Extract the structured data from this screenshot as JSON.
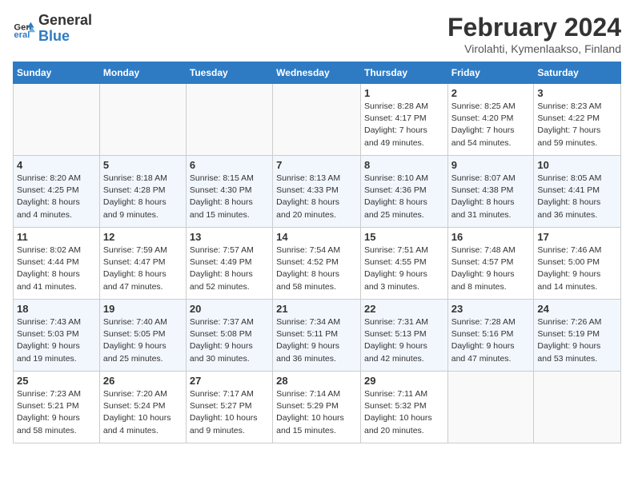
{
  "logo": {
    "line1": "General",
    "line2": "Blue"
  },
  "title": "February 2024",
  "location": "Virolahti, Kymenlaakso, Finland",
  "weekdays": [
    "Sunday",
    "Monday",
    "Tuesday",
    "Wednesday",
    "Thursday",
    "Friday",
    "Saturday"
  ],
  "weeks": [
    [
      {
        "day": "",
        "info": ""
      },
      {
        "day": "",
        "info": ""
      },
      {
        "day": "",
        "info": ""
      },
      {
        "day": "",
        "info": ""
      },
      {
        "day": "1",
        "info": "Sunrise: 8:28 AM\nSunset: 4:17 PM\nDaylight: 7 hours\nand 49 minutes."
      },
      {
        "day": "2",
        "info": "Sunrise: 8:25 AM\nSunset: 4:20 PM\nDaylight: 7 hours\nand 54 minutes."
      },
      {
        "day": "3",
        "info": "Sunrise: 8:23 AM\nSunset: 4:22 PM\nDaylight: 7 hours\nand 59 minutes."
      }
    ],
    [
      {
        "day": "4",
        "info": "Sunrise: 8:20 AM\nSunset: 4:25 PM\nDaylight: 8 hours\nand 4 minutes."
      },
      {
        "day": "5",
        "info": "Sunrise: 8:18 AM\nSunset: 4:28 PM\nDaylight: 8 hours\nand 9 minutes."
      },
      {
        "day": "6",
        "info": "Sunrise: 8:15 AM\nSunset: 4:30 PM\nDaylight: 8 hours\nand 15 minutes."
      },
      {
        "day": "7",
        "info": "Sunrise: 8:13 AM\nSunset: 4:33 PM\nDaylight: 8 hours\nand 20 minutes."
      },
      {
        "day": "8",
        "info": "Sunrise: 8:10 AM\nSunset: 4:36 PM\nDaylight: 8 hours\nand 25 minutes."
      },
      {
        "day": "9",
        "info": "Sunrise: 8:07 AM\nSunset: 4:38 PM\nDaylight: 8 hours\nand 31 minutes."
      },
      {
        "day": "10",
        "info": "Sunrise: 8:05 AM\nSunset: 4:41 PM\nDaylight: 8 hours\nand 36 minutes."
      }
    ],
    [
      {
        "day": "11",
        "info": "Sunrise: 8:02 AM\nSunset: 4:44 PM\nDaylight: 8 hours\nand 41 minutes."
      },
      {
        "day": "12",
        "info": "Sunrise: 7:59 AM\nSunset: 4:47 PM\nDaylight: 8 hours\nand 47 minutes."
      },
      {
        "day": "13",
        "info": "Sunrise: 7:57 AM\nSunset: 4:49 PM\nDaylight: 8 hours\nand 52 minutes."
      },
      {
        "day": "14",
        "info": "Sunrise: 7:54 AM\nSunset: 4:52 PM\nDaylight: 8 hours\nand 58 minutes."
      },
      {
        "day": "15",
        "info": "Sunrise: 7:51 AM\nSunset: 4:55 PM\nDaylight: 9 hours\nand 3 minutes."
      },
      {
        "day": "16",
        "info": "Sunrise: 7:48 AM\nSunset: 4:57 PM\nDaylight: 9 hours\nand 8 minutes."
      },
      {
        "day": "17",
        "info": "Sunrise: 7:46 AM\nSunset: 5:00 PM\nDaylight: 9 hours\nand 14 minutes."
      }
    ],
    [
      {
        "day": "18",
        "info": "Sunrise: 7:43 AM\nSunset: 5:03 PM\nDaylight: 9 hours\nand 19 minutes."
      },
      {
        "day": "19",
        "info": "Sunrise: 7:40 AM\nSunset: 5:05 PM\nDaylight: 9 hours\nand 25 minutes."
      },
      {
        "day": "20",
        "info": "Sunrise: 7:37 AM\nSunset: 5:08 PM\nDaylight: 9 hours\nand 30 minutes."
      },
      {
        "day": "21",
        "info": "Sunrise: 7:34 AM\nSunset: 5:11 PM\nDaylight: 9 hours\nand 36 minutes."
      },
      {
        "day": "22",
        "info": "Sunrise: 7:31 AM\nSunset: 5:13 PM\nDaylight: 9 hours\nand 42 minutes."
      },
      {
        "day": "23",
        "info": "Sunrise: 7:28 AM\nSunset: 5:16 PM\nDaylight: 9 hours\nand 47 minutes."
      },
      {
        "day": "24",
        "info": "Sunrise: 7:26 AM\nSunset: 5:19 PM\nDaylight: 9 hours\nand 53 minutes."
      }
    ],
    [
      {
        "day": "25",
        "info": "Sunrise: 7:23 AM\nSunset: 5:21 PM\nDaylight: 9 hours\nand 58 minutes."
      },
      {
        "day": "26",
        "info": "Sunrise: 7:20 AM\nSunset: 5:24 PM\nDaylight: 10 hours\nand 4 minutes."
      },
      {
        "day": "27",
        "info": "Sunrise: 7:17 AM\nSunset: 5:27 PM\nDaylight: 10 hours\nand 9 minutes."
      },
      {
        "day": "28",
        "info": "Sunrise: 7:14 AM\nSunset: 5:29 PM\nDaylight: 10 hours\nand 15 minutes."
      },
      {
        "day": "29",
        "info": "Sunrise: 7:11 AM\nSunset: 5:32 PM\nDaylight: 10 hours\nand 20 minutes."
      },
      {
        "day": "",
        "info": ""
      },
      {
        "day": "",
        "info": ""
      }
    ]
  ]
}
